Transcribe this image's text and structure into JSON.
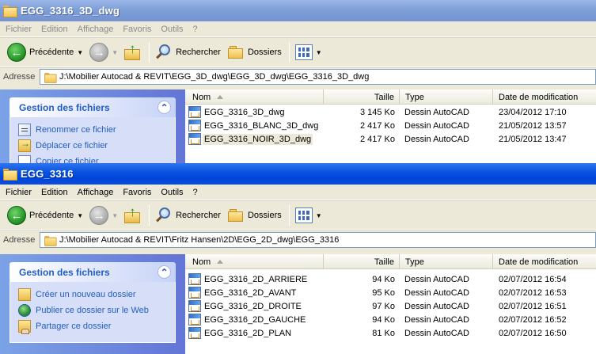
{
  "window1": {
    "title": "EGG_3316_3D_dwg",
    "menu": [
      "Fichier",
      "Edition",
      "Affichage",
      "Favoris",
      "Outils",
      "?"
    ],
    "toolbar": {
      "back": "Précédente",
      "search": "Rechercher",
      "folders": "Dossiers"
    },
    "address": {
      "label": "Adresse",
      "path": "J:\\Mobilier Autocad & REVIT\\EGG_3D_dwg\\EGG_3D_dwg\\EGG_3316_3D_dwg"
    },
    "tasks": {
      "title": "Gestion des fichiers",
      "items": [
        "Renommer ce fichier",
        "Déplacer ce fichier",
        "Copier ce fichier"
      ]
    },
    "columns": {
      "name": "Nom",
      "size": "Taille",
      "type": "Type",
      "date": "Date de modification"
    },
    "files": [
      {
        "name": "EGG_3316_3D_dwg",
        "size": "3 145 Ko",
        "type": "Dessin AutoCAD",
        "date": "23/04/2012 17:10"
      },
      {
        "name": "EGG_3316_BLANC_3D_dwg",
        "size": "2 417 Ko",
        "type": "Dessin AutoCAD",
        "date": "21/05/2012 13:57"
      },
      {
        "name": "EGG_3316_NOIR_3D_dwg",
        "size": "2 417 Ko",
        "type": "Dessin AutoCAD",
        "date": "21/05/2012 13:47"
      }
    ]
  },
  "window2": {
    "title": "EGG_3316",
    "menu": [
      "Fichier",
      "Edition",
      "Affichage",
      "Favoris",
      "Outils",
      "?"
    ],
    "toolbar": {
      "back": "Précédente",
      "search": "Rechercher",
      "folders": "Dossiers"
    },
    "address": {
      "label": "Adresse",
      "path": "J:\\Mobilier Autocad & REVIT\\Fritz Hansen\\2D\\EGG_2D_dwg\\EGG_3316"
    },
    "tasks": {
      "title": "Gestion des fichiers",
      "items": [
        "Créer un nouveau dossier",
        "Publier ce dossier sur le Web",
        "Partager ce dossier"
      ]
    },
    "columns": {
      "name": "Nom",
      "size": "Taille",
      "type": "Type",
      "date": "Date de modification"
    },
    "files": [
      {
        "name": "EGG_3316_2D_ARRIERE",
        "size": "94 Ko",
        "type": "Dessin AutoCAD",
        "date": "02/07/2012 16:54"
      },
      {
        "name": "EGG_3316_2D_AVANT",
        "size": "95 Ko",
        "type": "Dessin AutoCAD",
        "date": "02/07/2012 16:53"
      },
      {
        "name": "EGG_3316_2D_DROITE",
        "size": "97 Ko",
        "type": "Dessin AutoCAD",
        "date": "02/07/2012 16:51"
      },
      {
        "name": "EGG_3316_2D_GAUCHE",
        "size": "94 Ko",
        "type": "Dessin AutoCAD",
        "date": "02/07/2012 16:52"
      },
      {
        "name": "EGG_3316_2D_PLAN",
        "size": "81 Ko",
        "type": "Dessin AutoCAD",
        "date": "02/07/2012 16:50"
      }
    ]
  }
}
